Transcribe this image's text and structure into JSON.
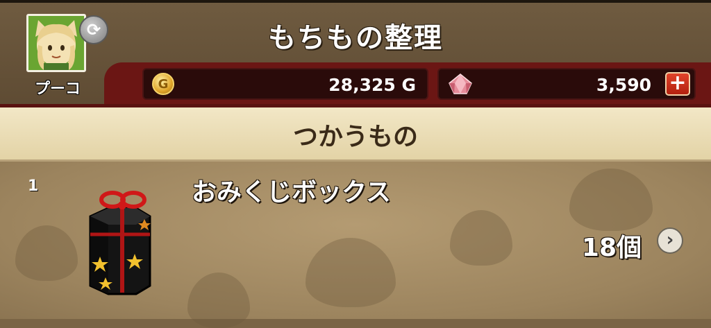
{
  "header": {
    "title": "もちもの整理",
    "player_name": "プーコ",
    "avatar_icon": "player-portrait-icon",
    "refresh_icon": "refresh-icon"
  },
  "currency": {
    "gold": {
      "value": "28,325 G",
      "icon": "gold-coin-icon"
    },
    "gems": {
      "value": "3,590",
      "icon": "gem-icon",
      "add_label": "+"
    }
  },
  "category": {
    "title": "つかうもの"
  },
  "items": [
    {
      "index": "1",
      "name": "おみくじボックス",
      "quantity": "18個",
      "icon": "gift-box-icon",
      "detail_icon": "chevron-right-icon"
    }
  ],
  "colors": {
    "header_background": "#6f5b40",
    "currency_band": "#6b1614",
    "category_bar": "#f2e7c6",
    "list_background": "#b49b72",
    "plus_button": "#d8321e"
  }
}
